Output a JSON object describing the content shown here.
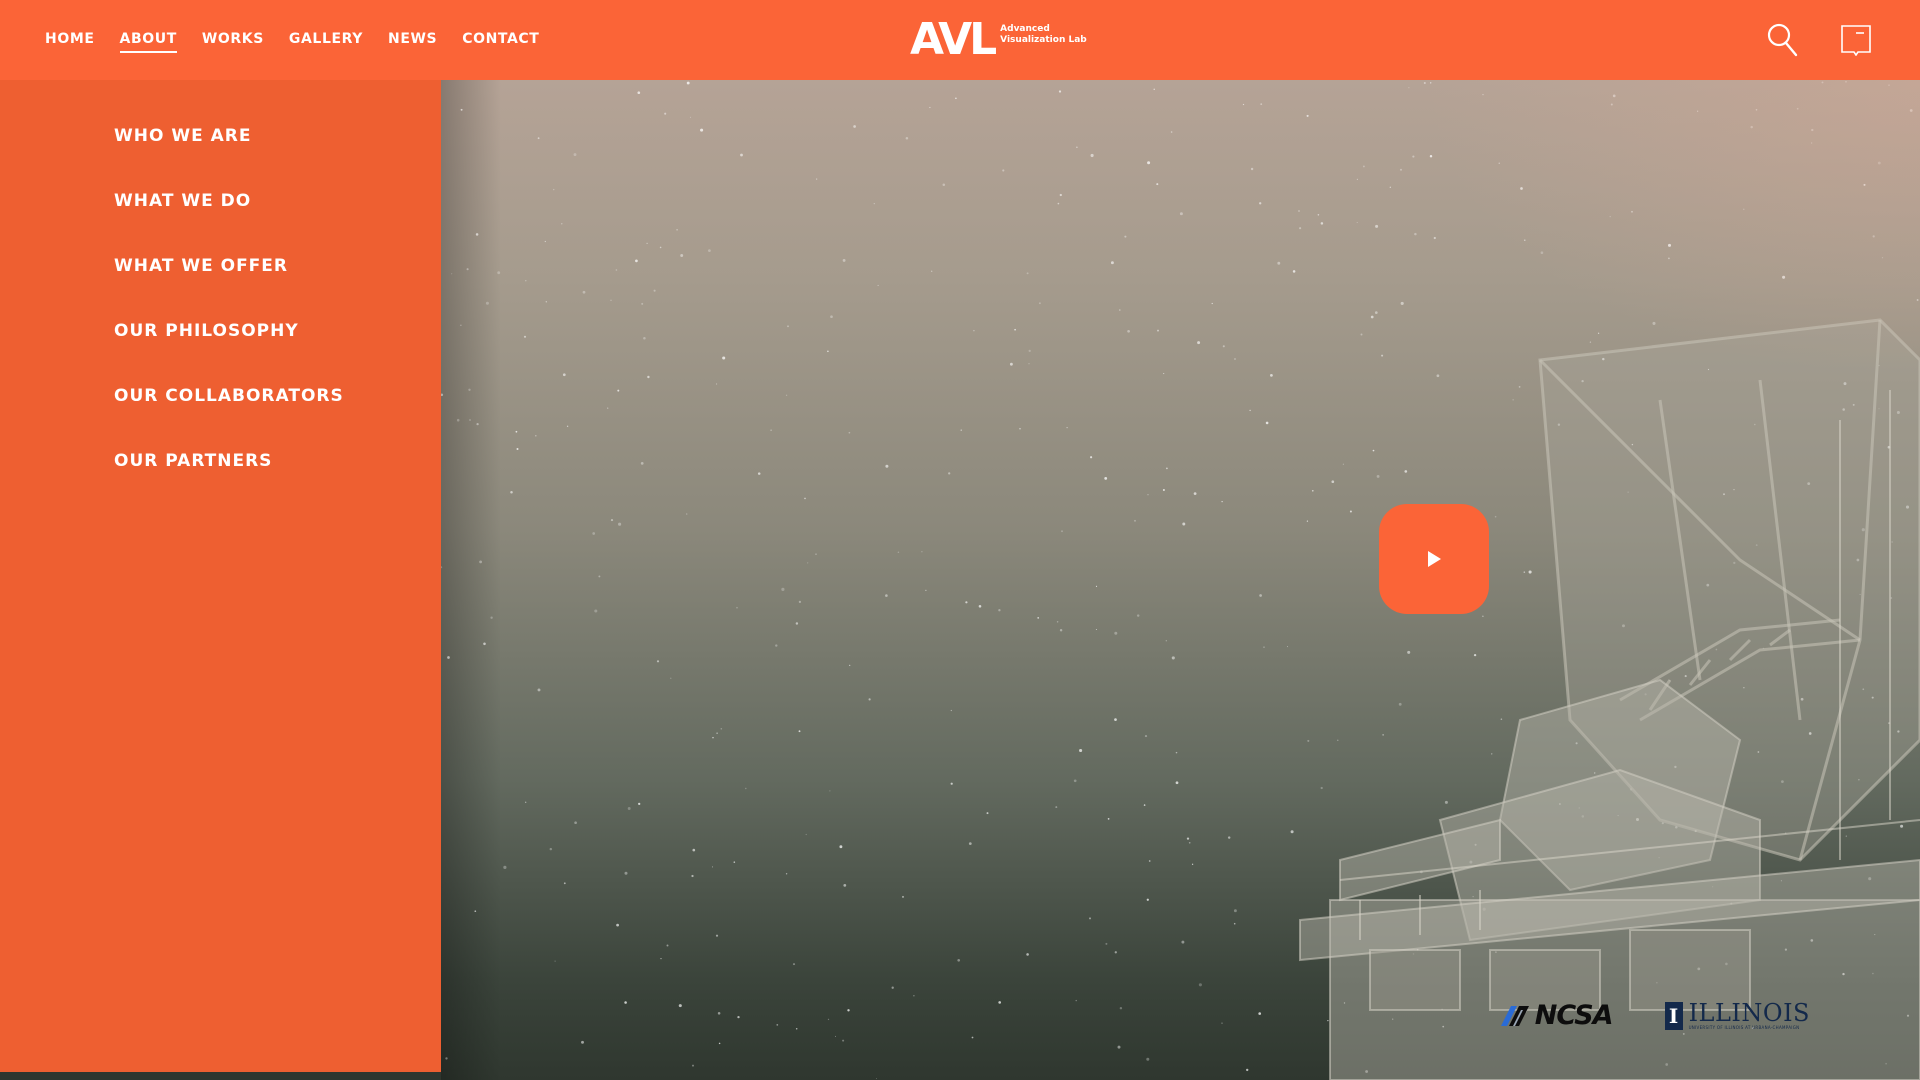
{
  "nav": {
    "items": [
      {
        "label": "HOME"
      },
      {
        "label": "ABOUT"
      },
      {
        "label": "WORKS"
      },
      {
        "label": "GALLERY"
      },
      {
        "label": "NEWS"
      },
      {
        "label": "CONTACT"
      }
    ],
    "active": "ABOUT"
  },
  "logo": {
    "mark": "AVL",
    "line1": "Advanced",
    "line2": "Visualization Lab"
  },
  "header_icons": {
    "search": "search-icon",
    "bookmark": "bookmark-icon"
  },
  "about_menu": {
    "items": [
      {
        "label": "WHO WE ARE"
      },
      {
        "label": "WHAT WE DO"
      },
      {
        "label": "WHAT WE OFFER"
      },
      {
        "label": "OUR PHILOSOPHY"
      },
      {
        "label": "OUR COLLABORATORS"
      },
      {
        "label": "OUR PARTNERS"
      }
    ]
  },
  "hero": {
    "play_icon": "play-icon"
  },
  "partners": {
    "ncsa": "NCSA",
    "illinois": "ILLINOIS",
    "illinois_sub": "UNIVERSITY OF ILLINOIS AT URBANA-CHAMPAIGN"
  },
  "colors": {
    "brand_orange": "#fb6437",
    "menu_orange": "#ee5f31",
    "illinois_blue": "#13294b"
  }
}
